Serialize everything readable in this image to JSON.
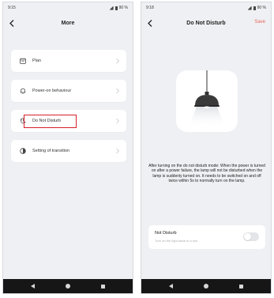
{
  "left": {
    "status": {
      "time": "9:15",
      "battery": "90 %"
    },
    "title": "More",
    "menu": [
      {
        "label": "Plan",
        "icon": "calendar-icon"
      },
      {
        "label": "Power-on behaviour",
        "icon": "bell-icon"
      },
      {
        "label": "Do Not Disturb",
        "icon": "moon-icon"
      },
      {
        "label": "Setting of transition",
        "icon": "transition-icon"
      }
    ],
    "highlight_color": "#d6202a"
  },
  "right": {
    "status": {
      "time": "9:18",
      "battery": "90 %"
    },
    "title": "Do Not Disturb",
    "save_label": "Save",
    "description": "After turning on the do not disturb mode: When the power is turned on after a power failure, the lamp will not be disturbed when the lamp is suddenly turned on. It needs to be switched on and off twice within 5s to normally turn on the lamp.",
    "setting": {
      "title": "Not Disturb",
      "subtitle": "Turn on the light twice in a row",
      "enabled": false
    }
  },
  "colors": {
    "accent": "#e8625b",
    "background": "#eef0f3",
    "navbar": "#161616"
  }
}
